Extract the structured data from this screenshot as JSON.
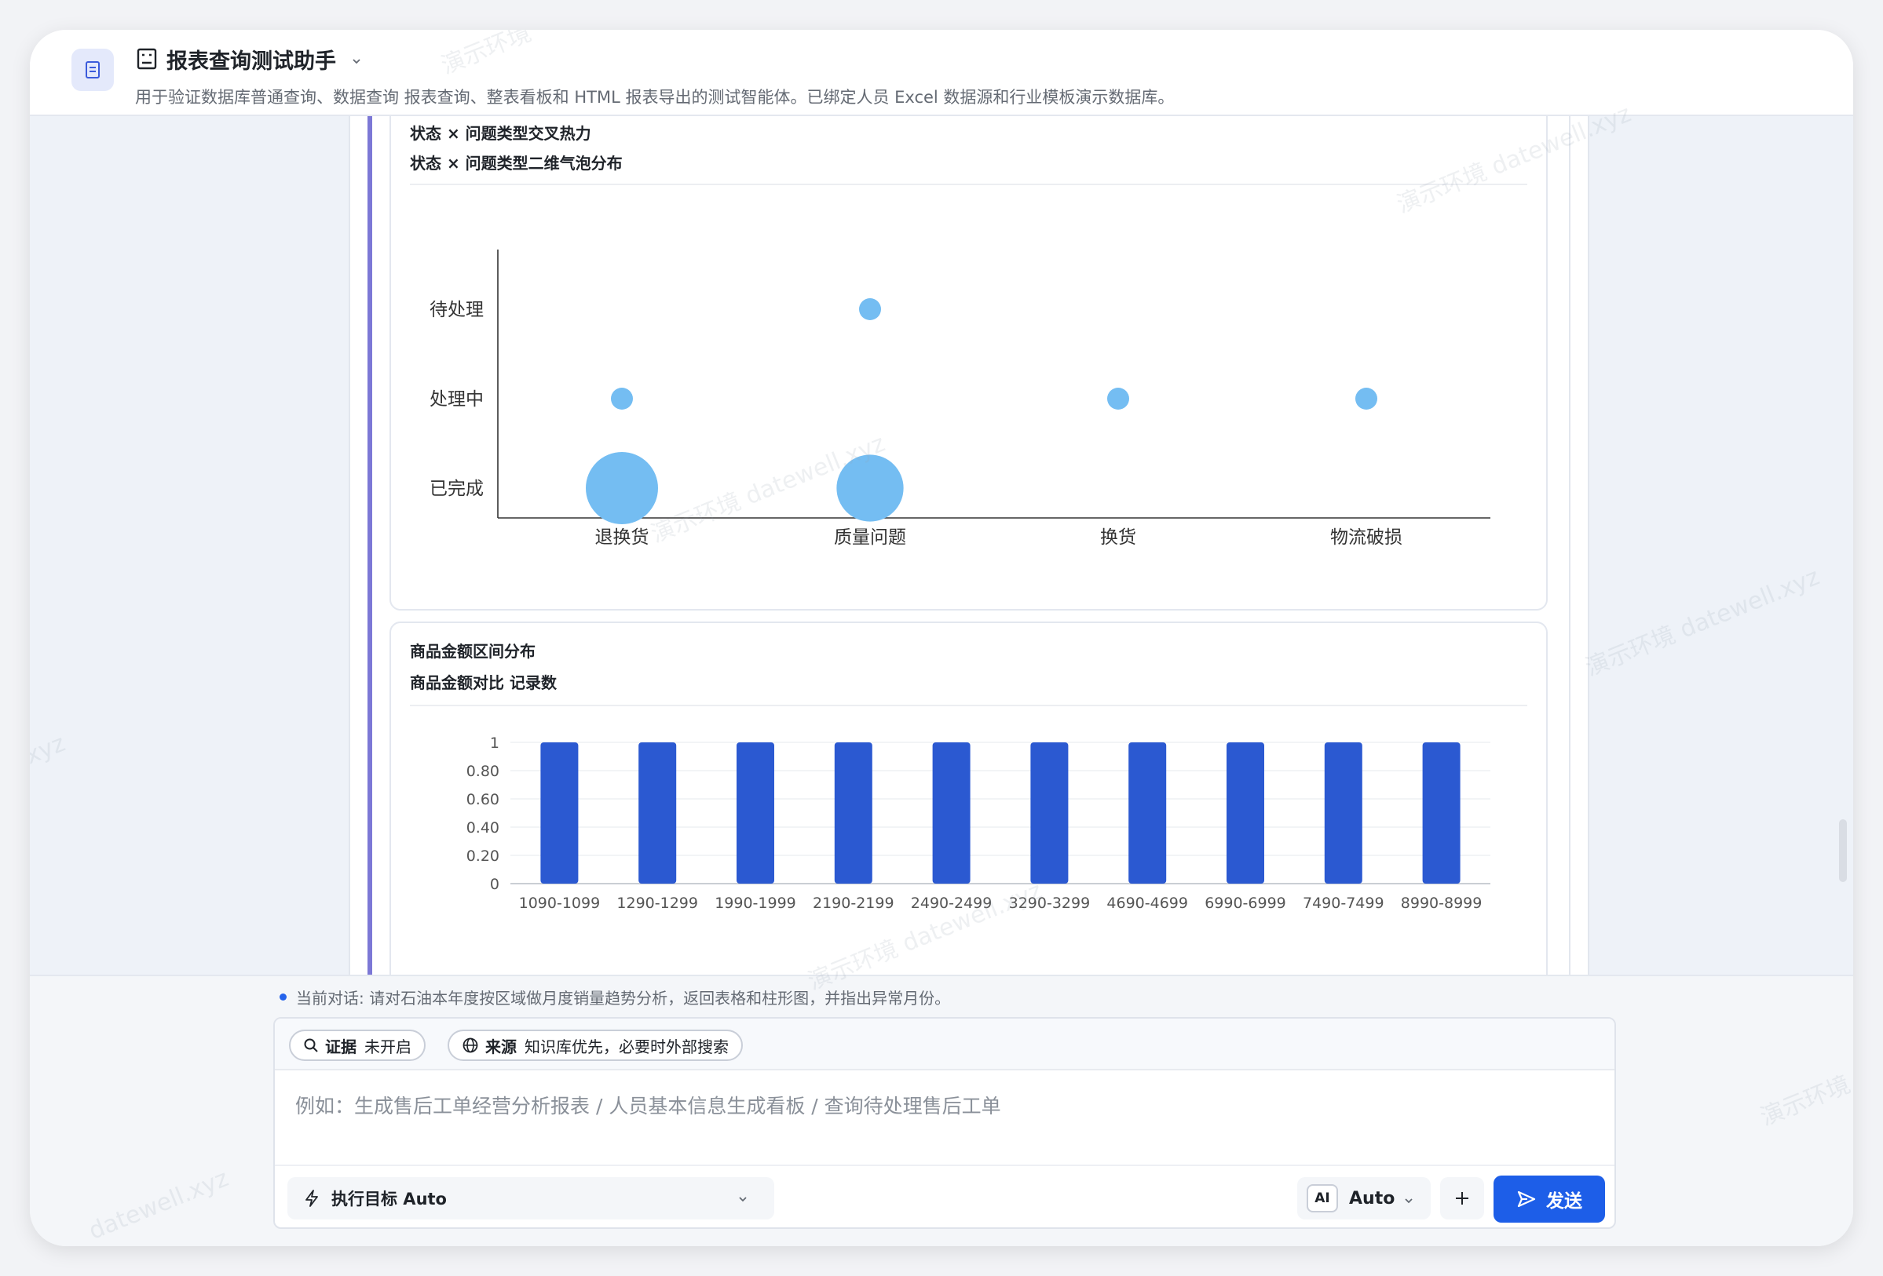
{
  "header": {
    "title": "报表查询测试助手",
    "subtitle": "用于验证数据库普通查询、数据查询 报表查询、整表看板和 HTML 报表导出的测试智能体。已绑定人员 Excel 数据源和行业模板演示数据库。"
  },
  "watermarks": [
    "演示环境",
    "演示环境 datewell.xyz",
    "xyz",
    "datewell.xyz"
  ],
  "cards": [
    {
      "title_line1": "状态 × 问题类型交叉热力",
      "title_line2": "状态 × 问题类型二维气泡分布"
    },
    {
      "title_line1": "商品金额区间分布",
      "title_line2": "商品金额对比 记录数"
    }
  ],
  "chart_data": [
    {
      "type": "scatter",
      "subtype": "bubble",
      "x_categories": [
        "退换货",
        "质量问题",
        "换货",
        "物流破损"
      ],
      "y_categories": [
        "已完成",
        "处理中",
        "待处理"
      ],
      "points": [
        {
          "x": "质量问题",
          "y": "待处理",
          "size": 1
        },
        {
          "x": "退换货",
          "y": "处理中",
          "size": 1
        },
        {
          "x": "换货",
          "y": "处理中",
          "size": 1
        },
        {
          "x": "物流破损",
          "y": "处理中",
          "size": 1
        },
        {
          "x": "退换货",
          "y": "已完成",
          "size": 6
        },
        {
          "x": "质量问题",
          "y": "已完成",
          "size": 5
        }
      ],
      "color": "#74bdf2",
      "grid": false
    },
    {
      "type": "bar",
      "categories": [
        "1090-1099",
        "1290-1299",
        "1990-1999",
        "2190-2199",
        "2490-2499",
        "3290-3299",
        "4690-4699",
        "6990-6999",
        "7490-7499",
        "8990-8999"
      ],
      "values": [
        1,
        1,
        1,
        1,
        1,
        1,
        1,
        1,
        1,
        1
      ],
      "ylim": [
        0,
        1
      ],
      "yticks": [
        "0",
        "0.20",
        "0.40",
        "0.60",
        "0.80",
        "1"
      ],
      "color": "#2b59d1",
      "grid": true
    }
  ],
  "footer": {
    "context": "当前对话: 请对石油本年度按区域做月度销量趋势分析，返回表格和柱形图，并指出异常月份。",
    "chip_evidence_key": "证据",
    "chip_evidence_val": "未开启",
    "chip_source_key": "来源",
    "chip_source_val": "知识库优先，必要时外部搜索",
    "placeholder": "例如：生成售后工单经营分析报表 / 人员基本信息生成看板 / 查询待处理售后工单",
    "target_label": "执行目标 Auto",
    "ai_badge": "AI",
    "model_label": "Auto",
    "send_label": "发送"
  }
}
